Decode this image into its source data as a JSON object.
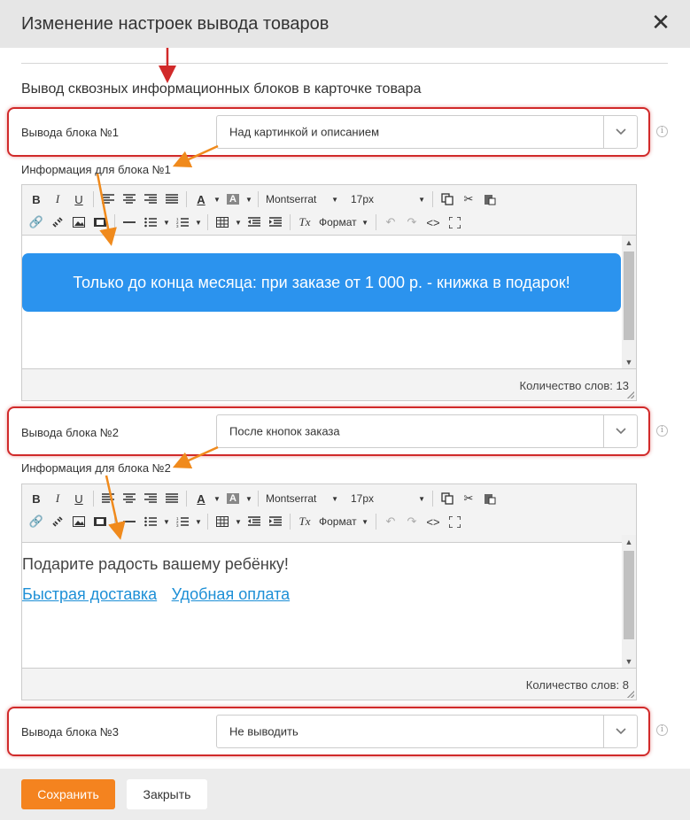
{
  "dialog": {
    "title": "Изменение настроек вывода товаров",
    "close_icon": "close-icon",
    "section_title": "Вывод сквозных информационных блоков в карточке товара"
  },
  "blocks": [
    {
      "label": "Вывода блока №1",
      "selected": "Над картинкой и описанием",
      "info_label": "Информация для блока №1",
      "content_banner": "Только до конца месяца: при заказе от 1 000 р. - книжка в подарок!",
      "word_count": "Количество слов: 13"
    },
    {
      "label": "Вывода блока №2",
      "selected": "После кнопок заказа",
      "info_label": "Информация для блока №2",
      "content_text": "Подарите радость вашему ребёнку!",
      "content_link1": "Быстрая доставка",
      "content_link2": "Удобная оплата",
      "word_count": "Количество слов: 8"
    },
    {
      "label": "Вывода блока №3",
      "selected": "Не выводить"
    }
  ],
  "toolbar": {
    "bold": "B",
    "italic": "I",
    "underline": "U",
    "font_name": "Montserrat",
    "font_size": "17px",
    "format": "Формат",
    "clear_format": "Tx",
    "source": "<>"
  },
  "footer": {
    "save_label": "Сохранить",
    "close_label": "Закрыть"
  },
  "colors": {
    "accent_orange": "#f4831f",
    "highlight_red": "#d12a2a",
    "banner_blue": "#2b93ee",
    "link_blue": "#1d8fd6"
  }
}
